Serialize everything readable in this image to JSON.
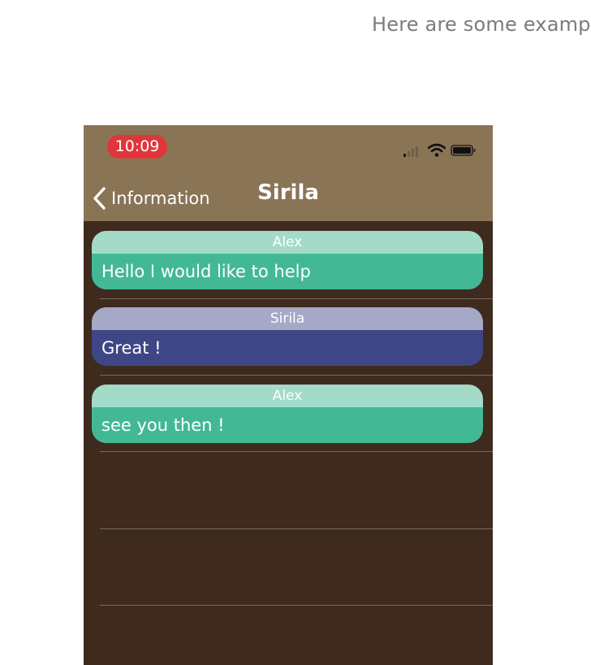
{
  "intro_text": "Here are some exampl",
  "status_bar": {
    "time": "10:09"
  },
  "nav": {
    "back_label": "Information",
    "title": "Sirila"
  },
  "messages": [
    {
      "sender": "Alex",
      "text": "Hello I would like to help"
    },
    {
      "sender": "Sirila",
      "text": "Great !"
    },
    {
      "sender": "Alex",
      "text": "see you then !"
    }
  ],
  "colors": {
    "nav_bar": "#8a7456",
    "background": "#3f2a1e",
    "time_pill": "#e0363a",
    "alex_header": "#a3dac8",
    "alex_body": "#42b994",
    "sirila_header": "#a5a8c6",
    "sirila_body": "#3e4686"
  },
  "icons": [
    "chevron-left-icon",
    "signal-icon",
    "wifi-icon",
    "battery-icon"
  ]
}
